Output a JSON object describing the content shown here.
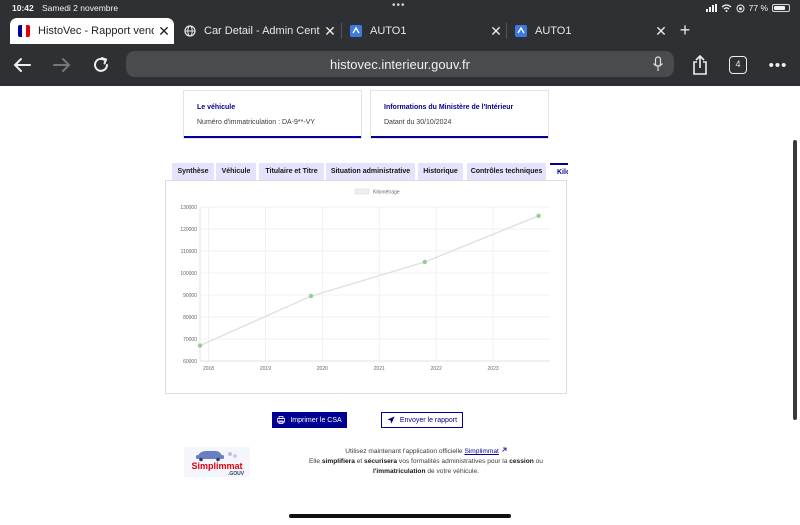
{
  "status_bar": {
    "time": "10:42",
    "date": "Samedi 2 novembre",
    "battery": "77 %",
    "battery_level": 0.77
  },
  "tabs": [
    {
      "title": "HistoVec - Rapport vendeur",
      "icon": "french-republic-icon",
      "active": true
    },
    {
      "title": "Car Detail - Admin Center",
      "icon": "globe-icon",
      "active": false
    },
    {
      "title": "AUTO1",
      "icon": "auto1-icon",
      "active": false
    },
    {
      "title": "AUTO1",
      "icon": "auto1-icon",
      "active": false
    }
  ],
  "toolbar": {
    "url": "histovec.interieur.gouv.fr",
    "tab_count": "4"
  },
  "cards": {
    "vehicle": {
      "title": "Le véhicule",
      "text": "Numéro d'immatriculation : DA-9**-VY"
    },
    "ministry": {
      "title": "Informations du Ministère de l'Intérieur",
      "text": "Datant du 30/10/2024"
    }
  },
  "report_tabs": [
    "Synthèse",
    "Véhicule",
    "Titulaire et Titre",
    "Situation administrative",
    "Historique",
    "Contrôles techniques",
    "Kilométrage"
  ],
  "chart_data": {
    "type": "line",
    "legend": "Kilométrage",
    "legend_position": "top-center",
    "grid": true,
    "x": [
      2017.85,
      2019.8,
      2021.8,
      2023.8
    ],
    "values": [
      67000,
      89500,
      105000,
      126000
    ],
    "xticks": [
      "2018",
      "2019",
      "2020",
      "2021",
      "2022",
      "2023"
    ],
    "xtick_values": [
      2018,
      2019,
      2020,
      2021,
      2022,
      2023
    ],
    "yticks": [
      "60000",
      "70000",
      "80000",
      "90000",
      "100000",
      "110000",
      "120000",
      "130000"
    ],
    "ylim": [
      60000,
      130000
    ],
    "xlim": [
      2017.85,
      2024.0
    ],
    "line_color": "#e0e0e0",
    "point_color": "#8fcf8f"
  },
  "buttons": {
    "print": "Imprimer le CSA",
    "send": "Envoyer le rapport"
  },
  "promo": {
    "line1_prefix": "Utilisez maintenant l'application officielle",
    "link": "Simplimmat",
    "line2_a": "Elle",
    "line2_b": "simplifiera",
    "line2_c": "et",
    "line2_d": "sécurisera",
    "line2_e": "vos formalités administratives pour la",
    "line2_f": "cession",
    "line2_g": "ou",
    "line3_a": "l'immatriculation",
    "line3_b": "de votre véhicule."
  },
  "logo": {
    "name": "Simplimmat",
    "suffix": ".GOUV"
  },
  "colors": {
    "brand_blue": "#000091",
    "tab_bg": "#e3e3fd",
    "chrome": "#2f3033"
  }
}
